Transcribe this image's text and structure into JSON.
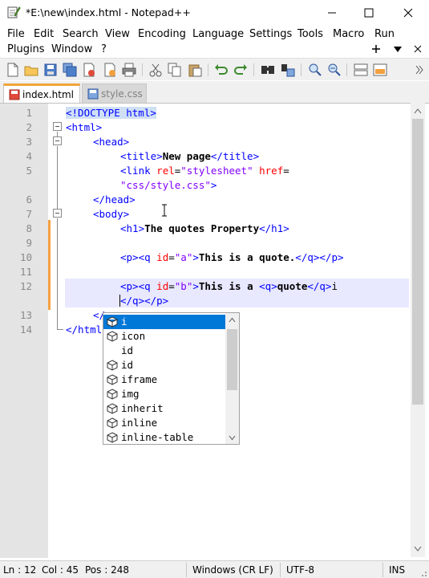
{
  "window": {
    "title": "*E:\\new\\index.html - Notepad++",
    "controls": [
      "minimize",
      "maximize",
      "close"
    ]
  },
  "menu": {
    "row1": [
      "File",
      "Edit",
      "Search",
      "View",
      "Encoding",
      "Language",
      "Settings",
      "Tools",
      "Macro",
      "Run"
    ],
    "row2": [
      "Plugins",
      "Window",
      "?"
    ]
  },
  "toolbar": {
    "icons": [
      "new-file-icon",
      "open-file-icon",
      "save-icon",
      "save-all-icon",
      "close-icon",
      "close-all-icon",
      "print-icon",
      "cut-icon",
      "copy-icon",
      "paste-icon",
      "undo-icon",
      "redo-icon",
      "find-icon",
      "replace-icon",
      "zoom-in-icon",
      "zoom-out-icon",
      "sync-v-icon",
      "sync-h-icon"
    ]
  },
  "tabs": [
    {
      "label": "index.html",
      "active": true
    },
    {
      "label": "style.css",
      "active": false
    }
  ],
  "editor": {
    "line_numbers": [
      "1",
      "2",
      "3",
      "4",
      "5",
      "6",
      "7",
      "8",
      "9",
      "10",
      "11",
      "12",
      "13",
      "14"
    ],
    "lines": {
      "l1": "<!DOCTYPE html>",
      "l2": "<html>",
      "l3": "<head>",
      "l4_open": "<title>",
      "l4_text": "New page",
      "l4_close": "</title>",
      "l5_tag": "<link",
      "l5_attr1": "rel",
      "l5_eq1": "=",
      "l5_val1": "\"stylesheet\"",
      "l5_attr2": "href",
      "l5_eq2": "=",
      "l5_val2": "\"css/style.css\"",
      "l5_end": ">",
      "l6": "</head>",
      "l7": "<body>",
      "l8_open": "<h1>",
      "l8_text": "The quotes Property",
      "l8_close": "</h1>",
      "l10_p": "<p>",
      "l10_q": "<q",
      "l10_attr": "id",
      "l10_eq": "=",
      "l10_val": "\"a\"",
      "l10_gt": ">",
      "l10_text": "This is a quote.",
      "l10_close": "</q></p>",
      "l12_p": "<p>",
      "l12_q": "<q",
      "l12_attr": "id",
      "l12_eq": "=",
      "l12_val": "\"b\"",
      "l12_gt": ">",
      "l12_text": "This is a ",
      "l12_q2": "<q>",
      "l12_text2": "quote",
      "l12_close": "</q>",
      "l12_i": "i",
      "l12_wrap": "</q></p>",
      "l13": "</",
      "l14": "</html"
    }
  },
  "autocomplete": {
    "items": [
      "i",
      "icon",
      "id",
      "id",
      "iframe",
      "img",
      "inherit",
      "inline",
      "inline-table"
    ],
    "selected": "i"
  },
  "status": {
    "ln": "Ln : 12",
    "col": "Col : 45",
    "pos": "Pos : 248",
    "eol": "Windows (CR LF)",
    "encoding": "UTF-8",
    "mode": "INS"
  },
  "colors": {
    "tag": "#0000ff",
    "attribute": "#ff0000",
    "value": "#8000ff",
    "selection": "#0078d7",
    "active_tab_accent": "#f1a43a",
    "change_marker": "#f6a141"
  }
}
